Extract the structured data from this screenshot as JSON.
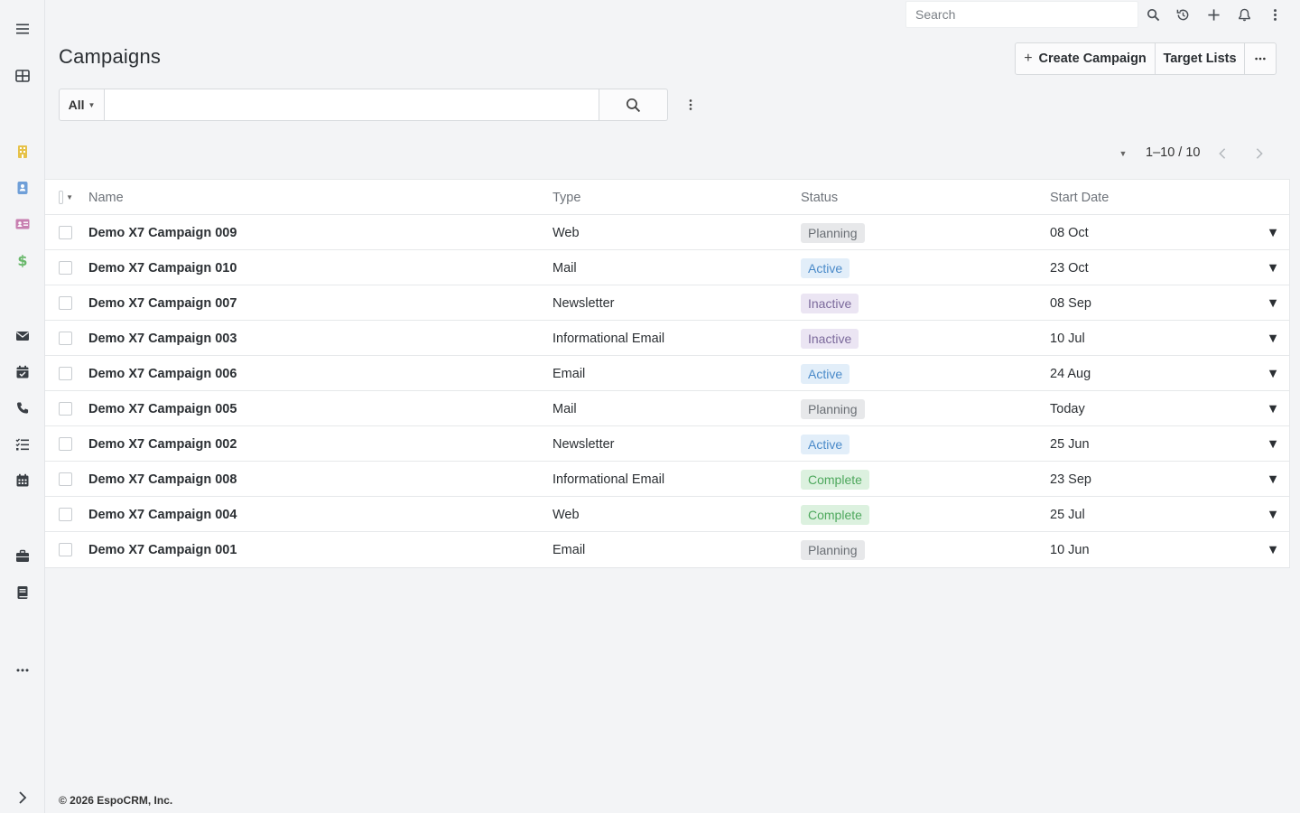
{
  "sidebar": {
    "items": [
      {
        "icon": "hamburger-icon",
        "color": "#3a3f45"
      },
      {
        "icon": "grid-table-icon",
        "color": "#3a3f45"
      },
      {
        "icon": "building-icon",
        "color": "#e6c24a"
      },
      {
        "icon": "contact-card-icon",
        "color": "#6f9fd8"
      },
      {
        "icon": "id-card-icon",
        "color": "#c77fb0"
      },
      {
        "icon": "dollar-icon",
        "color": "#69b86b"
      },
      {
        "icon": "envelope-icon",
        "color": "#3a3f45"
      },
      {
        "icon": "calendar-check-icon",
        "color": "#3a3f45"
      },
      {
        "icon": "phone-icon",
        "color": "#3a3f45"
      },
      {
        "icon": "tasks-icon",
        "color": "#3a3f45"
      },
      {
        "icon": "calendar-icon",
        "color": "#3a3f45"
      },
      {
        "icon": "briefcase-icon",
        "color": "#3a3f45"
      },
      {
        "icon": "book-icon",
        "color": "#3a3f45"
      },
      {
        "icon": "more-dots-icon",
        "color": "#3a3f45"
      },
      {
        "icon": "chevron-right-icon",
        "color": "#3a3f45"
      }
    ]
  },
  "topbar": {
    "search_placeholder": "Search"
  },
  "header": {
    "title": "Campaigns",
    "create_label": "Create Campaign",
    "create_plus": "+",
    "target_lists_label": "Target Lists",
    "more_label": "···"
  },
  "filter": {
    "scope": "All",
    "query": ""
  },
  "pagination": {
    "text": "1–10 / 10"
  },
  "table": {
    "columns": [
      "Name",
      "Type",
      "Status",
      "Start Date"
    ],
    "rows": [
      {
        "name": "Demo X7 Campaign 009",
        "type": "Web",
        "status": "Planning",
        "date": "08 Oct"
      },
      {
        "name": "Demo X7 Campaign 010",
        "type": "Mail",
        "status": "Active",
        "date": "23 Oct"
      },
      {
        "name": "Demo X7 Campaign 007",
        "type": "Newsletter",
        "status": "Inactive",
        "date": "08 Sep"
      },
      {
        "name": "Demo X7 Campaign 003",
        "type": "Informational Email",
        "status": "Inactive",
        "date": "10 Jul"
      },
      {
        "name": "Demo X7 Campaign 006",
        "type": "Email",
        "status": "Active",
        "date": "24 Aug"
      },
      {
        "name": "Demo X7 Campaign 005",
        "type": "Mail",
        "status": "Planning",
        "date": "Today"
      },
      {
        "name": "Demo X7 Campaign 002",
        "type": "Newsletter",
        "status": "Active",
        "date": "25 Jun"
      },
      {
        "name": "Demo X7 Campaign 008",
        "type": "Informational Email",
        "status": "Complete",
        "date": "23 Sep"
      },
      {
        "name": "Demo X7 Campaign 004",
        "type": "Web",
        "status": "Complete",
        "date": "25 Jul"
      },
      {
        "name": "Demo X7 Campaign 001",
        "type": "Email",
        "status": "Planning",
        "date": "10 Jun"
      }
    ]
  },
  "status_colors": {
    "Planning": {
      "bg": "#e7e8ea",
      "fg": "#6a6f75"
    },
    "Active": {
      "bg": "#e2eef9",
      "fg": "#4a8ac9"
    },
    "Inactive": {
      "bg": "#ebe5f3",
      "fg": "#7c6a9c"
    },
    "Complete": {
      "bg": "#dcf1df",
      "fg": "#4ea85d"
    }
  },
  "footer": {
    "text": "© 2026 EspoCRM, Inc."
  }
}
